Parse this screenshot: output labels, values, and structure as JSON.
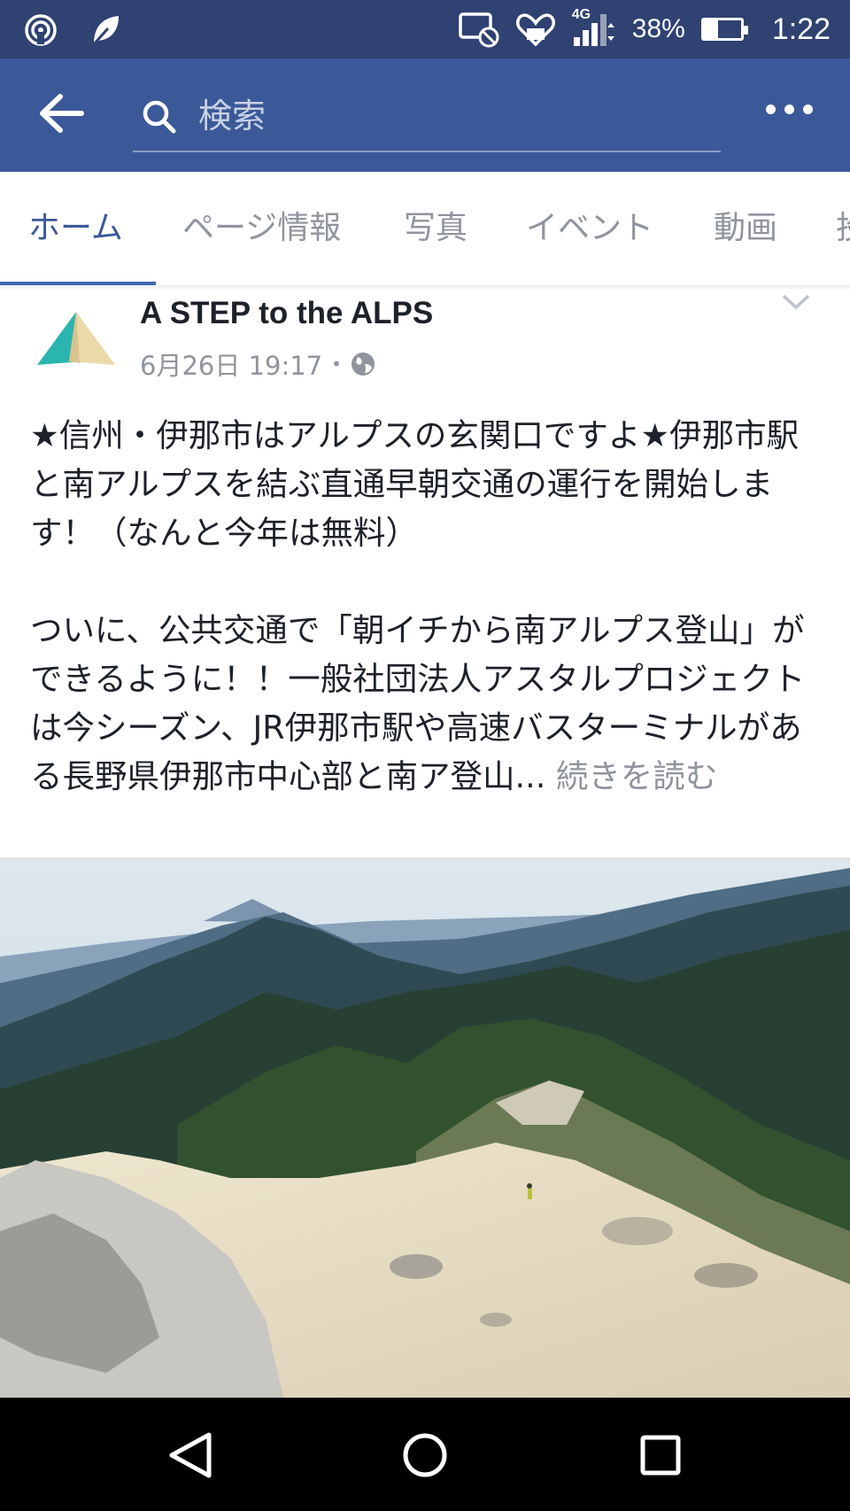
{
  "status_bar": {
    "battery": "38%",
    "battery_level": 0.38,
    "time": "1:22",
    "network": "4G",
    "icons": [
      "hotspot-icon",
      "leaf-icon",
      "cast-off-icon",
      "heart-mail-icon",
      "signal-icon",
      "battery-icon"
    ]
  },
  "app_bar": {
    "search_placeholder": "検索",
    "icons": [
      "back-arrow-icon",
      "search-icon",
      "more-dots-icon"
    ]
  },
  "tabs": [
    {
      "label": "ホーム",
      "active": true
    },
    {
      "label": "ページ情報",
      "active": false
    },
    {
      "label": "写真",
      "active": false
    },
    {
      "label": "イベント",
      "active": false
    },
    {
      "label": "動画",
      "active": false
    },
    {
      "label": "投",
      "active": false
    }
  ],
  "post": {
    "page_name": "A STEP to the ALPS",
    "date": "6月26日 19:17",
    "separator": "•",
    "privacy_icon": "globe-icon",
    "paragraph1": "★信州・伊那市はアルプスの玄関口ですよ★伊那市駅と南アルプスを結ぶ直通早朝交通の運行を開始します！（なんと今年は無料）",
    "paragraph2": "ついに、公共交通で「朝イチから南アルプス登山」ができるように！！一般社団法人アスタルプロジェクトは今シーズン、JR伊那市駅や高速バスターミナルがある長野県伊那市中心部と南ア登山...",
    "see_more": "続きを読む"
  },
  "colors": {
    "facebook_blue": "#3b5998",
    "status_bar": "#2f4271",
    "tab_active": "#4267b2",
    "muted_text": "#90949c",
    "logo_teal": "#2bb5b0",
    "logo_sand": "#ecd9a8"
  },
  "nav_bar": {
    "icons": [
      "back-triangle-icon",
      "home-circle-icon",
      "recents-square-icon"
    ]
  }
}
